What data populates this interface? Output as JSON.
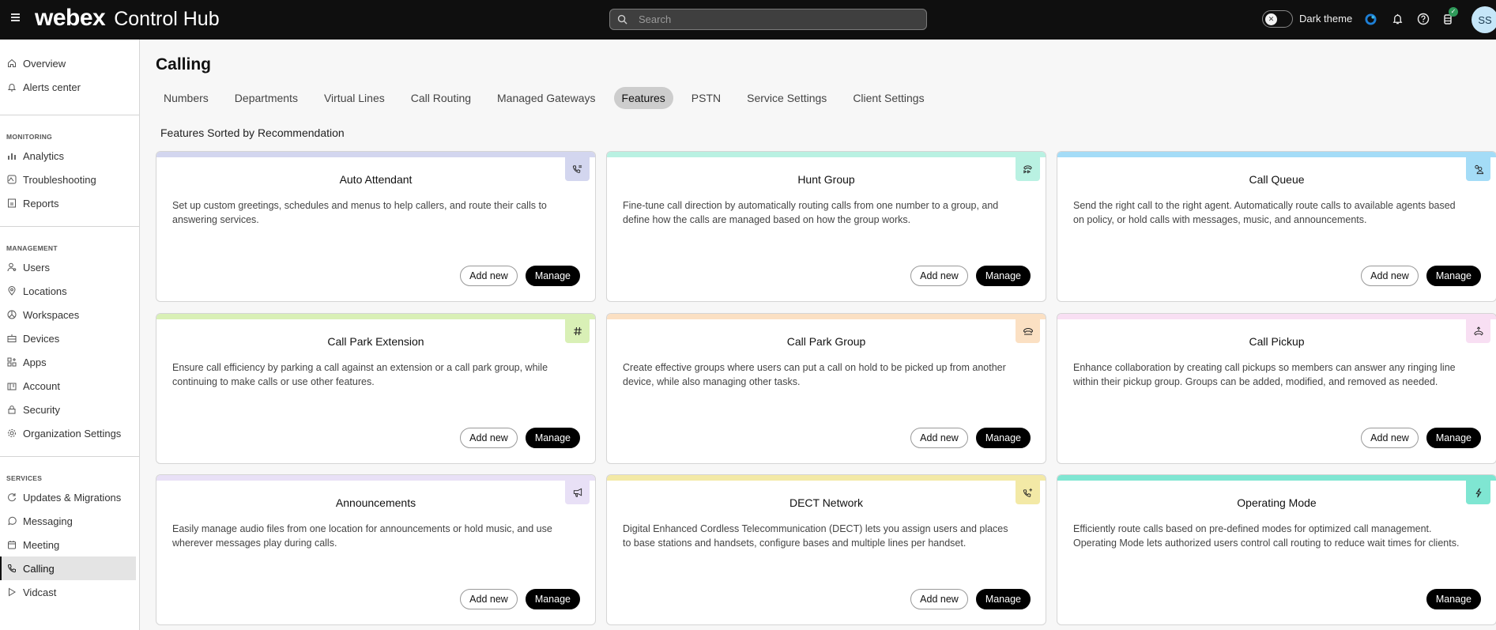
{
  "topbar": {
    "brand_name": "webex",
    "product_name": "Control Hub",
    "search_placeholder": "Search",
    "dark_theme_label": "Dark theme",
    "avatar_initials": "SS",
    "icons": [
      "menu-icon",
      "search-icon",
      "toggle-off-icon",
      "webex-status-icon",
      "bell-icon",
      "help-icon",
      "tasks-icon"
    ]
  },
  "sidebar": {
    "top_items": [
      {
        "label": "Overview",
        "icon": "home-icon"
      },
      {
        "label": "Alerts center",
        "icon": "bell-icon"
      }
    ],
    "sections": [
      {
        "title": "MONITORING",
        "items": [
          {
            "label": "Analytics",
            "icon": "analytics-icon"
          },
          {
            "label": "Troubleshooting",
            "icon": "troubleshooting-icon"
          },
          {
            "label": "Reports",
            "icon": "reports-icon"
          }
        ]
      },
      {
        "title": "MANAGEMENT",
        "items": [
          {
            "label": "Users",
            "icon": "users-icon"
          },
          {
            "label": "Locations",
            "icon": "location-icon"
          },
          {
            "label": "Workspaces",
            "icon": "workspaces-icon"
          },
          {
            "label": "Devices",
            "icon": "devices-icon"
          },
          {
            "label": "Apps",
            "icon": "apps-icon"
          },
          {
            "label": "Account",
            "icon": "account-icon"
          },
          {
            "label": "Security",
            "icon": "lock-icon"
          },
          {
            "label": "Organization Settings",
            "icon": "gear-icon"
          }
        ]
      },
      {
        "title": "SERVICES",
        "items": [
          {
            "label": "Updates & Migrations",
            "icon": "refresh-icon"
          },
          {
            "label": "Messaging",
            "icon": "chat-icon"
          },
          {
            "label": "Meeting",
            "icon": "calendar-icon"
          },
          {
            "label": "Calling",
            "icon": "phone-icon",
            "active": true
          },
          {
            "label": "Vidcast",
            "icon": "play-icon"
          }
        ]
      }
    ]
  },
  "main": {
    "title": "Calling",
    "tabs": [
      {
        "label": "Numbers"
      },
      {
        "label": "Departments"
      },
      {
        "label": "Virtual Lines"
      },
      {
        "label": "Call Routing"
      },
      {
        "label": "Managed Gateways"
      },
      {
        "label": "Features",
        "active": true
      },
      {
        "label": "PSTN"
      },
      {
        "label": "Service Settings"
      },
      {
        "label": "Client Settings"
      }
    ],
    "subtitle": "Features Sorted by Recommendation",
    "add_new_label": "Add new",
    "manage_label": "Manage",
    "cards": [
      {
        "title": "Auto Attendant",
        "description": "Set up custom greetings, schedules and menus to help callers, and route their calls to answering services.",
        "icon": "auto-attendant-icon",
        "accent": "#d3d6ef",
        "has_add_new": true
      },
      {
        "title": "Hunt Group",
        "description": "Fine-tune call direction by automatically routing calls from one number to a group, and define how the calls are managed based on how the group works.",
        "icon": "hunt-group-icon",
        "accent": "#b9f1e2",
        "has_add_new": true
      },
      {
        "title": "Call Queue",
        "description": "Send the right call to the right agent. Automatically route calls to available agents based on policy, or hold calls with messages, music, and announcements.",
        "icon": "call-queue-icon",
        "accent": "#a4dcf7",
        "has_add_new": true
      },
      {
        "title": "Call Park Extension",
        "description": "Ensure call efficiency by parking a call against an extension or a call park group, while continuing to make calls or use other features.",
        "icon": "hash-icon",
        "accent": "#d9f0b6",
        "has_add_new": true
      },
      {
        "title": "Call Park Group",
        "description": "Create effective groups where users can put a call on hold to be picked up from another device, while also managing other tasks.",
        "icon": "call-park-group-icon",
        "accent": "#fbe0c3",
        "has_add_new": true
      },
      {
        "title": "Call Pickup",
        "description": "Enhance collaboration by creating call pickups so members can answer any ringing line within their pickup group. Groups can be added, modified, and removed as needed.",
        "icon": "call-pickup-icon",
        "accent": "#f8dff3",
        "has_add_new": true
      },
      {
        "title": "Announcements",
        "description": "Easily manage audio files from one location for announcements or hold music, and use wherever messages play during calls.",
        "icon": "megaphone-icon",
        "accent": "#e8e0f6",
        "has_add_new": true
      },
      {
        "title": "DECT Network",
        "description": "Digital Enhanced Cordless Telecommunication (DECT) lets you assign users and places to base stations and handsets, configure bases and multiple lines per handset.",
        "icon": "dect-icon",
        "accent": "#f3e9a6",
        "has_add_new": true
      },
      {
        "title": "Operating Mode",
        "description": "Efficiently route calls based on pre-defined modes for optimized call management. Operating Mode lets authorized users control call routing to reduce wait times for clients.",
        "icon": "lightning-icon",
        "accent": "#7fe6d2",
        "has_add_new": false
      }
    ]
  }
}
